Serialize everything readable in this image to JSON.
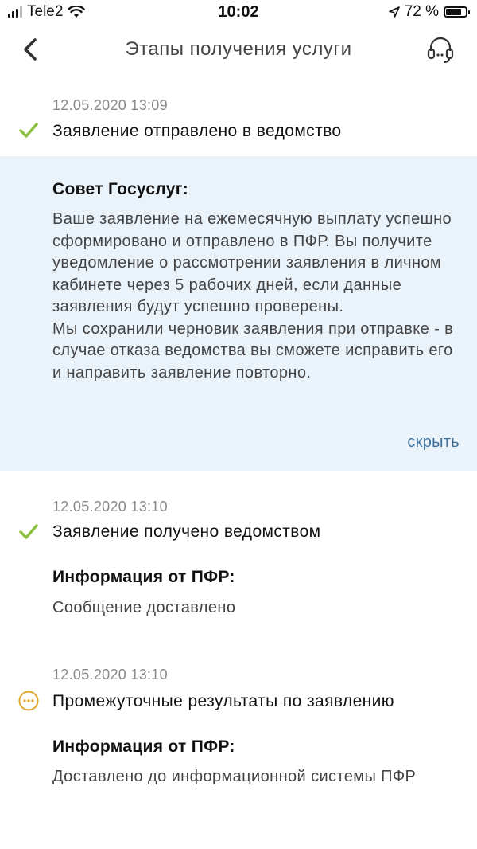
{
  "status_bar": {
    "carrier": "Tele2",
    "time": "10:02",
    "battery": "72 %",
    "battery_level": 0.72
  },
  "header": {
    "title": "Этапы получения услуги",
    "back_icon": "chevron-left-icon",
    "support_icon": "headset-icon"
  },
  "steps": [
    {
      "date": "12.05.2020 13:09",
      "title": "Заявление отправлено в ведомство",
      "status_icon": "check-icon",
      "status_color": "#8cbf3f"
    },
    {
      "date": "12.05.2020 13:10",
      "title": "Заявление получено ведомством",
      "status_icon": "check-icon",
      "status_color": "#8cbf3f",
      "info_label": "Информация от ПФР:",
      "info_value": "Сообщение доставлено"
    },
    {
      "date": "12.05.2020 13:10",
      "title": "Промежуточные результаты по заявлению",
      "status_icon": "more-dots-icon",
      "status_color": "#e0a82e",
      "info_label": "Информация от ПФР:",
      "info_value": "Доставлено до информационной системы ПФР"
    }
  ],
  "advice": {
    "title": "Совет Госуслуг:",
    "text": "Ваше заявление на ежемесячную выплату успешно сформировано и отправлено в ПФР. Вы получите уведомление о рассмотрении заявления в личном кабинете через 5 рабочих дней, если данные заявления будут успешно проверены.\nМы сохранили черновик заявления при отправке - в случае отказа ведомства вы сможете исправить его и направить заявление повторно.",
    "hide_label": "скрыть",
    "background": "#eaf2fa",
    "link_color": "#3d6f9a"
  }
}
